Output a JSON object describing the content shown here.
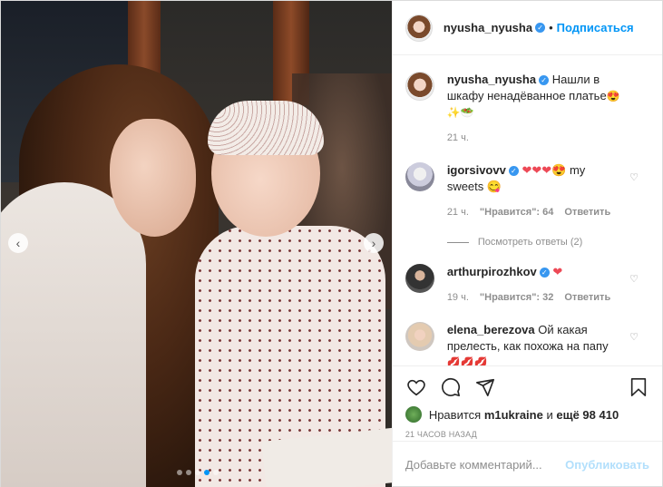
{
  "post": {
    "author": "nyusha_nyusha",
    "separator": "•",
    "follow_label": "Подписаться",
    "caption": "Нашли в шкафу ненадёванное платье",
    "caption_emoji": "😍✨🥗",
    "caption_time": "21 ч.",
    "photo_dots": 5,
    "photo_active_dot": 4
  },
  "comments": [
    {
      "username": "igorsivovv",
      "verified": true,
      "text": "❤❤❤😍",
      "text_tail": "my sweets 😋",
      "time": "21 ч.",
      "likes_label": "\"Нравится\": 64",
      "reply_label": "Ответить",
      "view_replies": "Посмотреть ответы (2)"
    },
    {
      "username": "arthurpirozhkov",
      "verified": true,
      "text": "❤",
      "time": "19 ч.",
      "likes_label": "\"Нравится\": 32",
      "reply_label": "Ответить"
    },
    {
      "username": "elena_berezova",
      "verified": false,
      "text": "Ой какая прелесть, как похожа на папу",
      "text_tail": "💋💋💋"
    }
  ],
  "likes": {
    "prefix": "Нравится",
    "user": "m1ukraine",
    "suffix": "и",
    "others": "ещё 98 410"
  },
  "timestamp": "21 ЧАСОВ НАЗАД",
  "add_comment": {
    "placeholder": "Добавьте комментарий...",
    "publish_label": "Опубликовать"
  },
  "colors": {
    "accent": "#0095f6",
    "verified": "#3897f0",
    "muted": "#8e8e8e",
    "publish_disabled": "#b2dffc"
  },
  "icons": [
    "heart-icon",
    "comment-icon",
    "share-icon",
    "bookmark-icon",
    "verified-icon",
    "chevron-left-icon",
    "chevron-right-icon"
  ]
}
